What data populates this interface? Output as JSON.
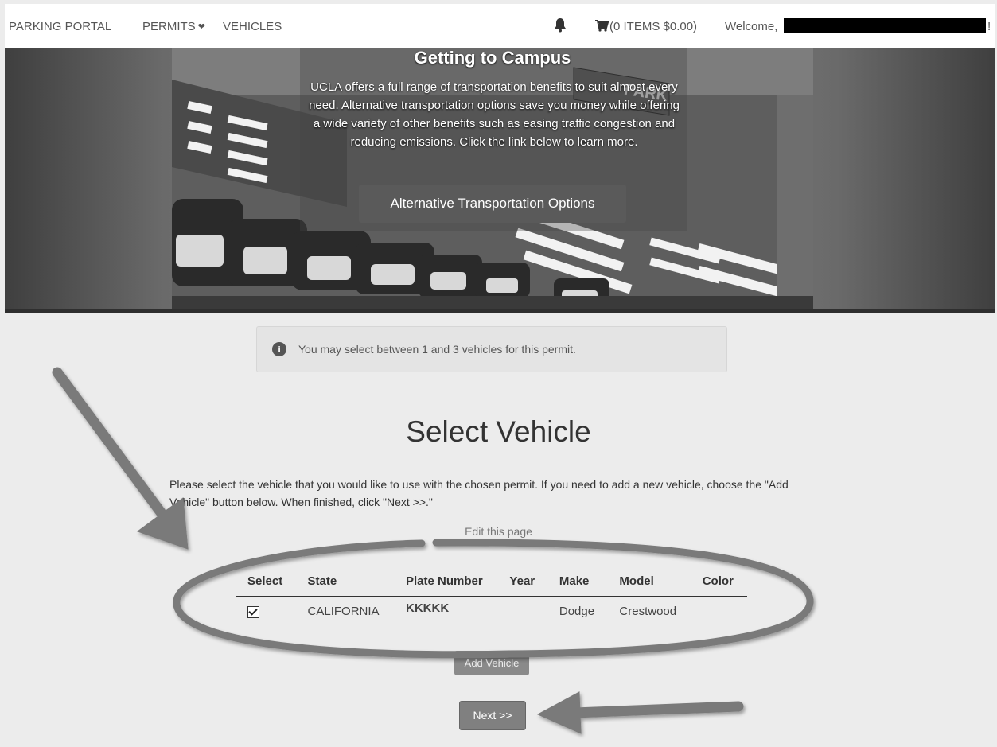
{
  "header": {
    "brand": "PARKING PORTAL",
    "nav": {
      "permits": "PERMITS",
      "vehicles": "VEHICLES"
    },
    "cart": "(0 ITEMS $0.00)",
    "welcome": "Welcome,",
    "welcome_suffix": "!"
  },
  "hero": {
    "title": "Getting to Campus",
    "text": "UCLA offers a full range of transportation benefits to suit almost every need. Alternative transportation options save you money while offering a wide variety of other benefits such as easing traffic congestion and reducing emissions. Click the link below to learn more.",
    "button": "Alternative Transportation Options",
    "sign_text": "PARK"
  },
  "info": {
    "icon": "i",
    "text": "You may select between 1 and 3 vehicles for this permit."
  },
  "main": {
    "title": "Select Vehicle",
    "instructions": "Please select the vehicle that you would like to use with the chosen permit. If you need to add a new vehicle, choose the \"Add Vehicle\" button below. When finished, click \"Next >>.\"",
    "edit_link": "Edit this page"
  },
  "table": {
    "headers": [
      "Select",
      "State",
      "Plate Number",
      "Year",
      "Make",
      "Model",
      "Color"
    ],
    "rows": [
      {
        "selected": true,
        "state": "CALIFORNIA",
        "plate": "KKKKK",
        "year": "",
        "make": "Dodge",
        "model": "Crestwood",
        "color": ""
      }
    ]
  },
  "buttons": {
    "add_vehicle": "Add Vehicle",
    "next": "Next >>"
  },
  "colors": {
    "annotation": "#7a7a7a",
    "redaction": "#000000"
  }
}
